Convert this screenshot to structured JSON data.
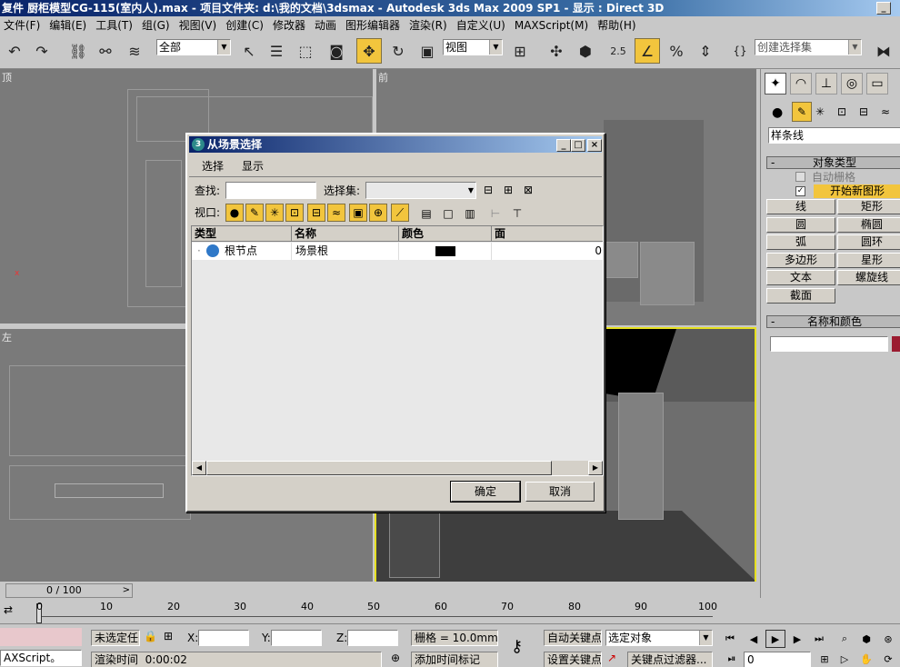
{
  "window": {
    "title": "复件 厨柜模型CG-115(室内人).max   - 项目文件夹: d:\\我的文档\\3dsmax    - Autodesk 3ds Max  2009 SP1    - 显示 : Direct 3D",
    "min_glyph": "_"
  },
  "menu": [
    "文件(F)",
    "编辑(E)",
    "工具(T)",
    "组(G)",
    "视图(V)",
    "创建(C)",
    "修改器",
    "动画",
    "图形编辑器",
    "渲染(R)",
    "自定义(U)",
    "MAXScript(M)",
    "帮助(H)"
  ],
  "toolbar": {
    "selection_filter": "全部",
    "ref_coord": "视图",
    "snap_value": "2.5",
    "named_selection_placeholder": "创建选择集"
  },
  "viewports": {
    "top": "顶",
    "front": "前",
    "left": "左"
  },
  "cmd_panel": {
    "type_dropdown": "样条线",
    "object_type_title": "对象类型",
    "autogrid": "自动栅格",
    "start_new_shape": "开始新图形",
    "check": "✓",
    "buttons": [
      "线",
      "矩形",
      "圆",
      "椭圆",
      "弧",
      "圆环",
      "多边形",
      "星形",
      "文本",
      "螺旋线",
      "截面"
    ],
    "name_color_title": "名称和颜色",
    "rollout_sign": "-",
    "object_color": "#9b1b30"
  },
  "dialog": {
    "title": "从场景选择",
    "menu_select": "选择",
    "menu_display": "显示",
    "find_label": "查找:",
    "find_value": "",
    "selset_label": "选择集:",
    "viewport_label": "视口:",
    "columns": [
      "类型",
      "名称",
      "颜色",
      "面"
    ],
    "row": {
      "type": "根节点",
      "name": "场景根",
      "color": "#000000",
      "faces": "0"
    },
    "ok": "确定",
    "cancel": "取消"
  },
  "timeline": {
    "frame_counter": "0 / 100",
    "ticks": [
      "0",
      "10",
      "20",
      "30",
      "40",
      "50",
      "60",
      "70",
      "80",
      "90",
      "100"
    ]
  },
  "status": {
    "maxscript": "AXScript。",
    "selection": "未选定任",
    "x_label": "X:",
    "y_label": "Y:",
    "z_label": "Z:",
    "x": "",
    "y": "",
    "z": "",
    "grid": "栅格 = 10.0mm",
    "render_time_label": "渲染时间",
    "render_time": "0:00:02",
    "add_time_tag": "添加时间标记",
    "auto_key": "自动关键点",
    "set_key": "设置关键点",
    "key_mode": "选定对象",
    "key_filters": "关键点过滤器...",
    "current_frame": "0"
  }
}
